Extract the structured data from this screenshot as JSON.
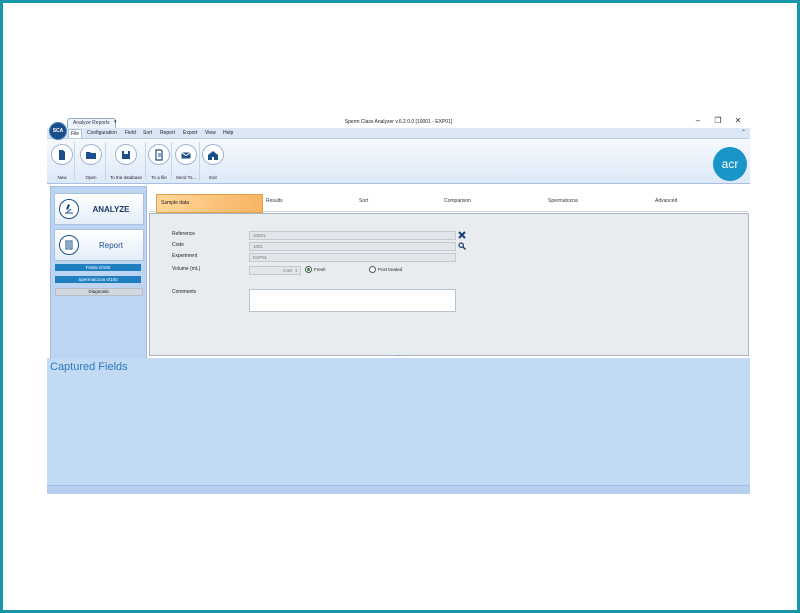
{
  "window": {
    "title": "Sperm Class Analyzer v.6.2.0.0  [10001 - EXP01]",
    "context_tab": "Analyze  Reports",
    "logo_text": "SCA",
    "controls": [
      "–",
      "❐",
      "✕"
    ]
  },
  "menu": [
    "File",
    "Configuration",
    "Field",
    "Sort",
    "Report",
    "Export",
    "View",
    "Help"
  ],
  "ribbon": {
    "buttons": [
      {
        "label": "New",
        "icon": "new-document-icon"
      },
      {
        "label": "Open",
        "icon": "open-folder-icon"
      },
      {
        "label": "To the database",
        "icon": "save-disk-icon"
      },
      {
        "label": "To a file",
        "icon": "file-export-icon"
      },
      {
        "label": "Send To...",
        "icon": "mail-icon"
      },
      {
        "label": "Exit",
        "icon": "home-icon"
      }
    ],
    "brand_text": "acr"
  },
  "left_panel": {
    "analyze_label": "ANALYZE",
    "report_label": "Report",
    "fields_status": "Fields 0/100",
    "spermatozoa_status": "Spermatozoa 0/100",
    "diagnostic_label": "Diagnostic"
  },
  "tabs": [
    "Sample data",
    "Results",
    "Sort",
    "Comparison",
    "Spermatozoa",
    "Advanced"
  ],
  "active_tab": "Sample data",
  "form": {
    "reference_label": "Reference",
    "reference_value": "10001",
    "code_label": "Code",
    "code_value": "1001",
    "experiment_label": "Experiment",
    "experiment_value": "EXP01",
    "volume_label": "Volume (mL)",
    "volume_value": "0.50",
    "radio_fresh": "Fresh",
    "radio_post": "Post treated",
    "selected_radio": "Fresh",
    "comments_label": "Comments",
    "comments_value": ""
  },
  "captured": {
    "title": "Captured Fields"
  },
  "colors": {
    "frame_border": "#1797a8",
    "accent_blue": "#1a95c8",
    "tab_active": "#f8b463",
    "pane_bg": "#bdd5f3"
  }
}
